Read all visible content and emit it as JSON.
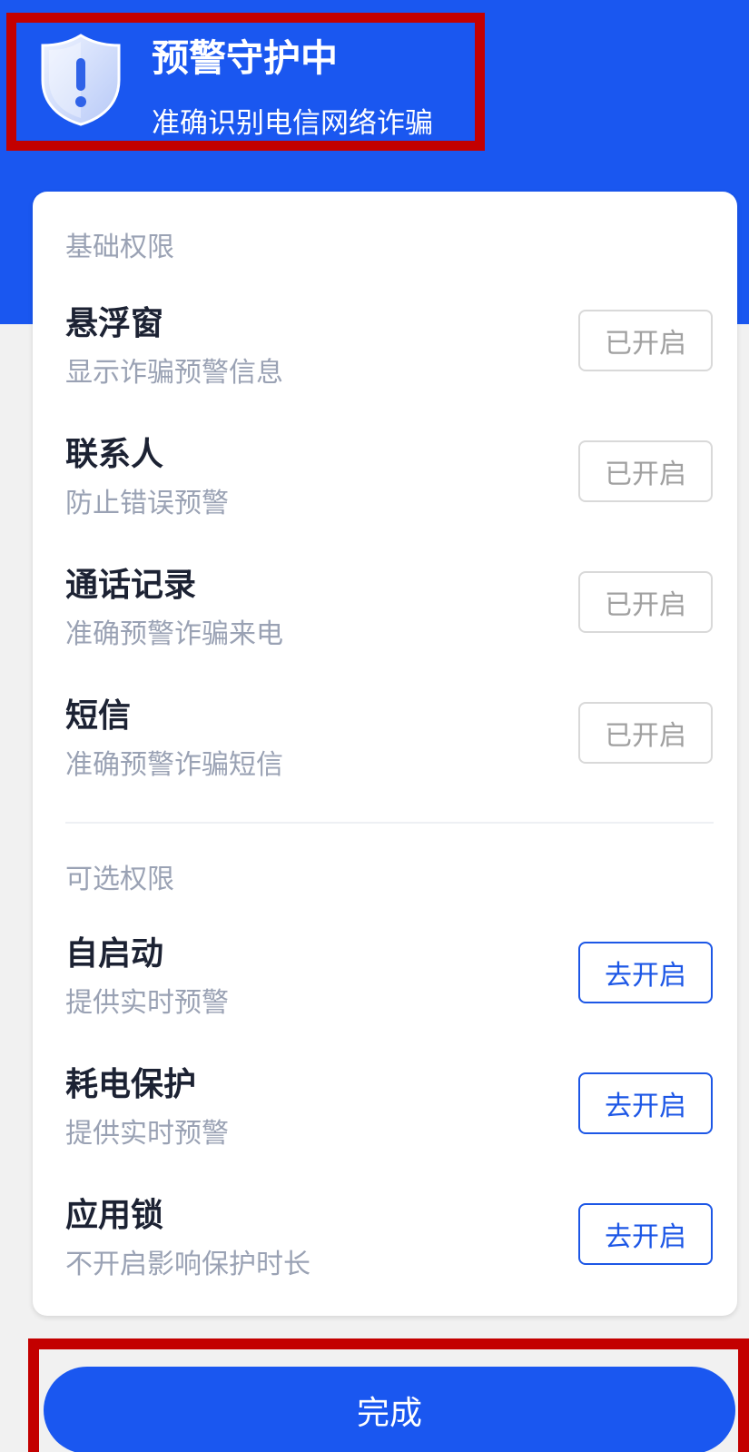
{
  "header": {
    "title": "预警守护中",
    "subtitle": "准确识别电信网络诈骗",
    "icon": "shield-alert-icon"
  },
  "basic": {
    "title": "基础权限",
    "items": [
      {
        "title": "悬浮窗",
        "desc": "显示诈骗预警信息",
        "button": "已开启"
      },
      {
        "title": "联系人",
        "desc": "防止错误预警",
        "button": "已开启"
      },
      {
        "title": "通话记录",
        "desc": "准确预警诈骗来电",
        "button": "已开启"
      },
      {
        "title": "短信",
        "desc": "准确预警诈骗短信",
        "button": "已开启"
      }
    ]
  },
  "optional": {
    "title": "可选权限",
    "items": [
      {
        "title": "自启动",
        "desc": "提供实时预警",
        "button": "去开启"
      },
      {
        "title": "耗电保护",
        "desc": "提供实时预警",
        "button": "去开启"
      },
      {
        "title": "应用锁",
        "desc": "不开启影响保护时长",
        "button": "去开启"
      }
    ]
  },
  "footer": {
    "done_label": "完成"
  },
  "colors": {
    "primary": "#1a57f0",
    "highlight_frame": "#c30000",
    "enabled_text": "#a0a0a0",
    "title_text": "#1c2233",
    "desc_text": "#9aa2b4"
  }
}
